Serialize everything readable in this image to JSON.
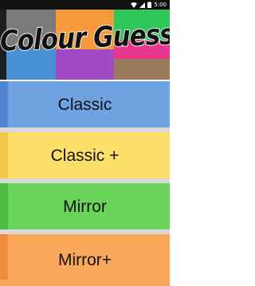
{
  "status": {
    "time": "5:00"
  },
  "banner": {
    "title": "Colour Guess",
    "tile_colors": [
      "#1e1e1e",
      "#7a7a7a",
      "#f59a3c",
      "#2fc75a",
      "#e8388d",
      "#4a90d6",
      "#a04ac6",
      "#9a7a5a"
    ]
  },
  "menu": {
    "buttons": [
      {
        "label": "Classic",
        "color": "#6fa2e0",
        "side": "#4f86cf"
      },
      {
        "label": "Classic +",
        "color": "#fde06a",
        "side": "#f2c94a"
      },
      {
        "label": "Mirror",
        "color": "#69d35a",
        "side": "#4dbb40"
      },
      {
        "label": "Mirror+",
        "color": "#fba85a",
        "side": "#f08b3a"
      }
    ]
  }
}
